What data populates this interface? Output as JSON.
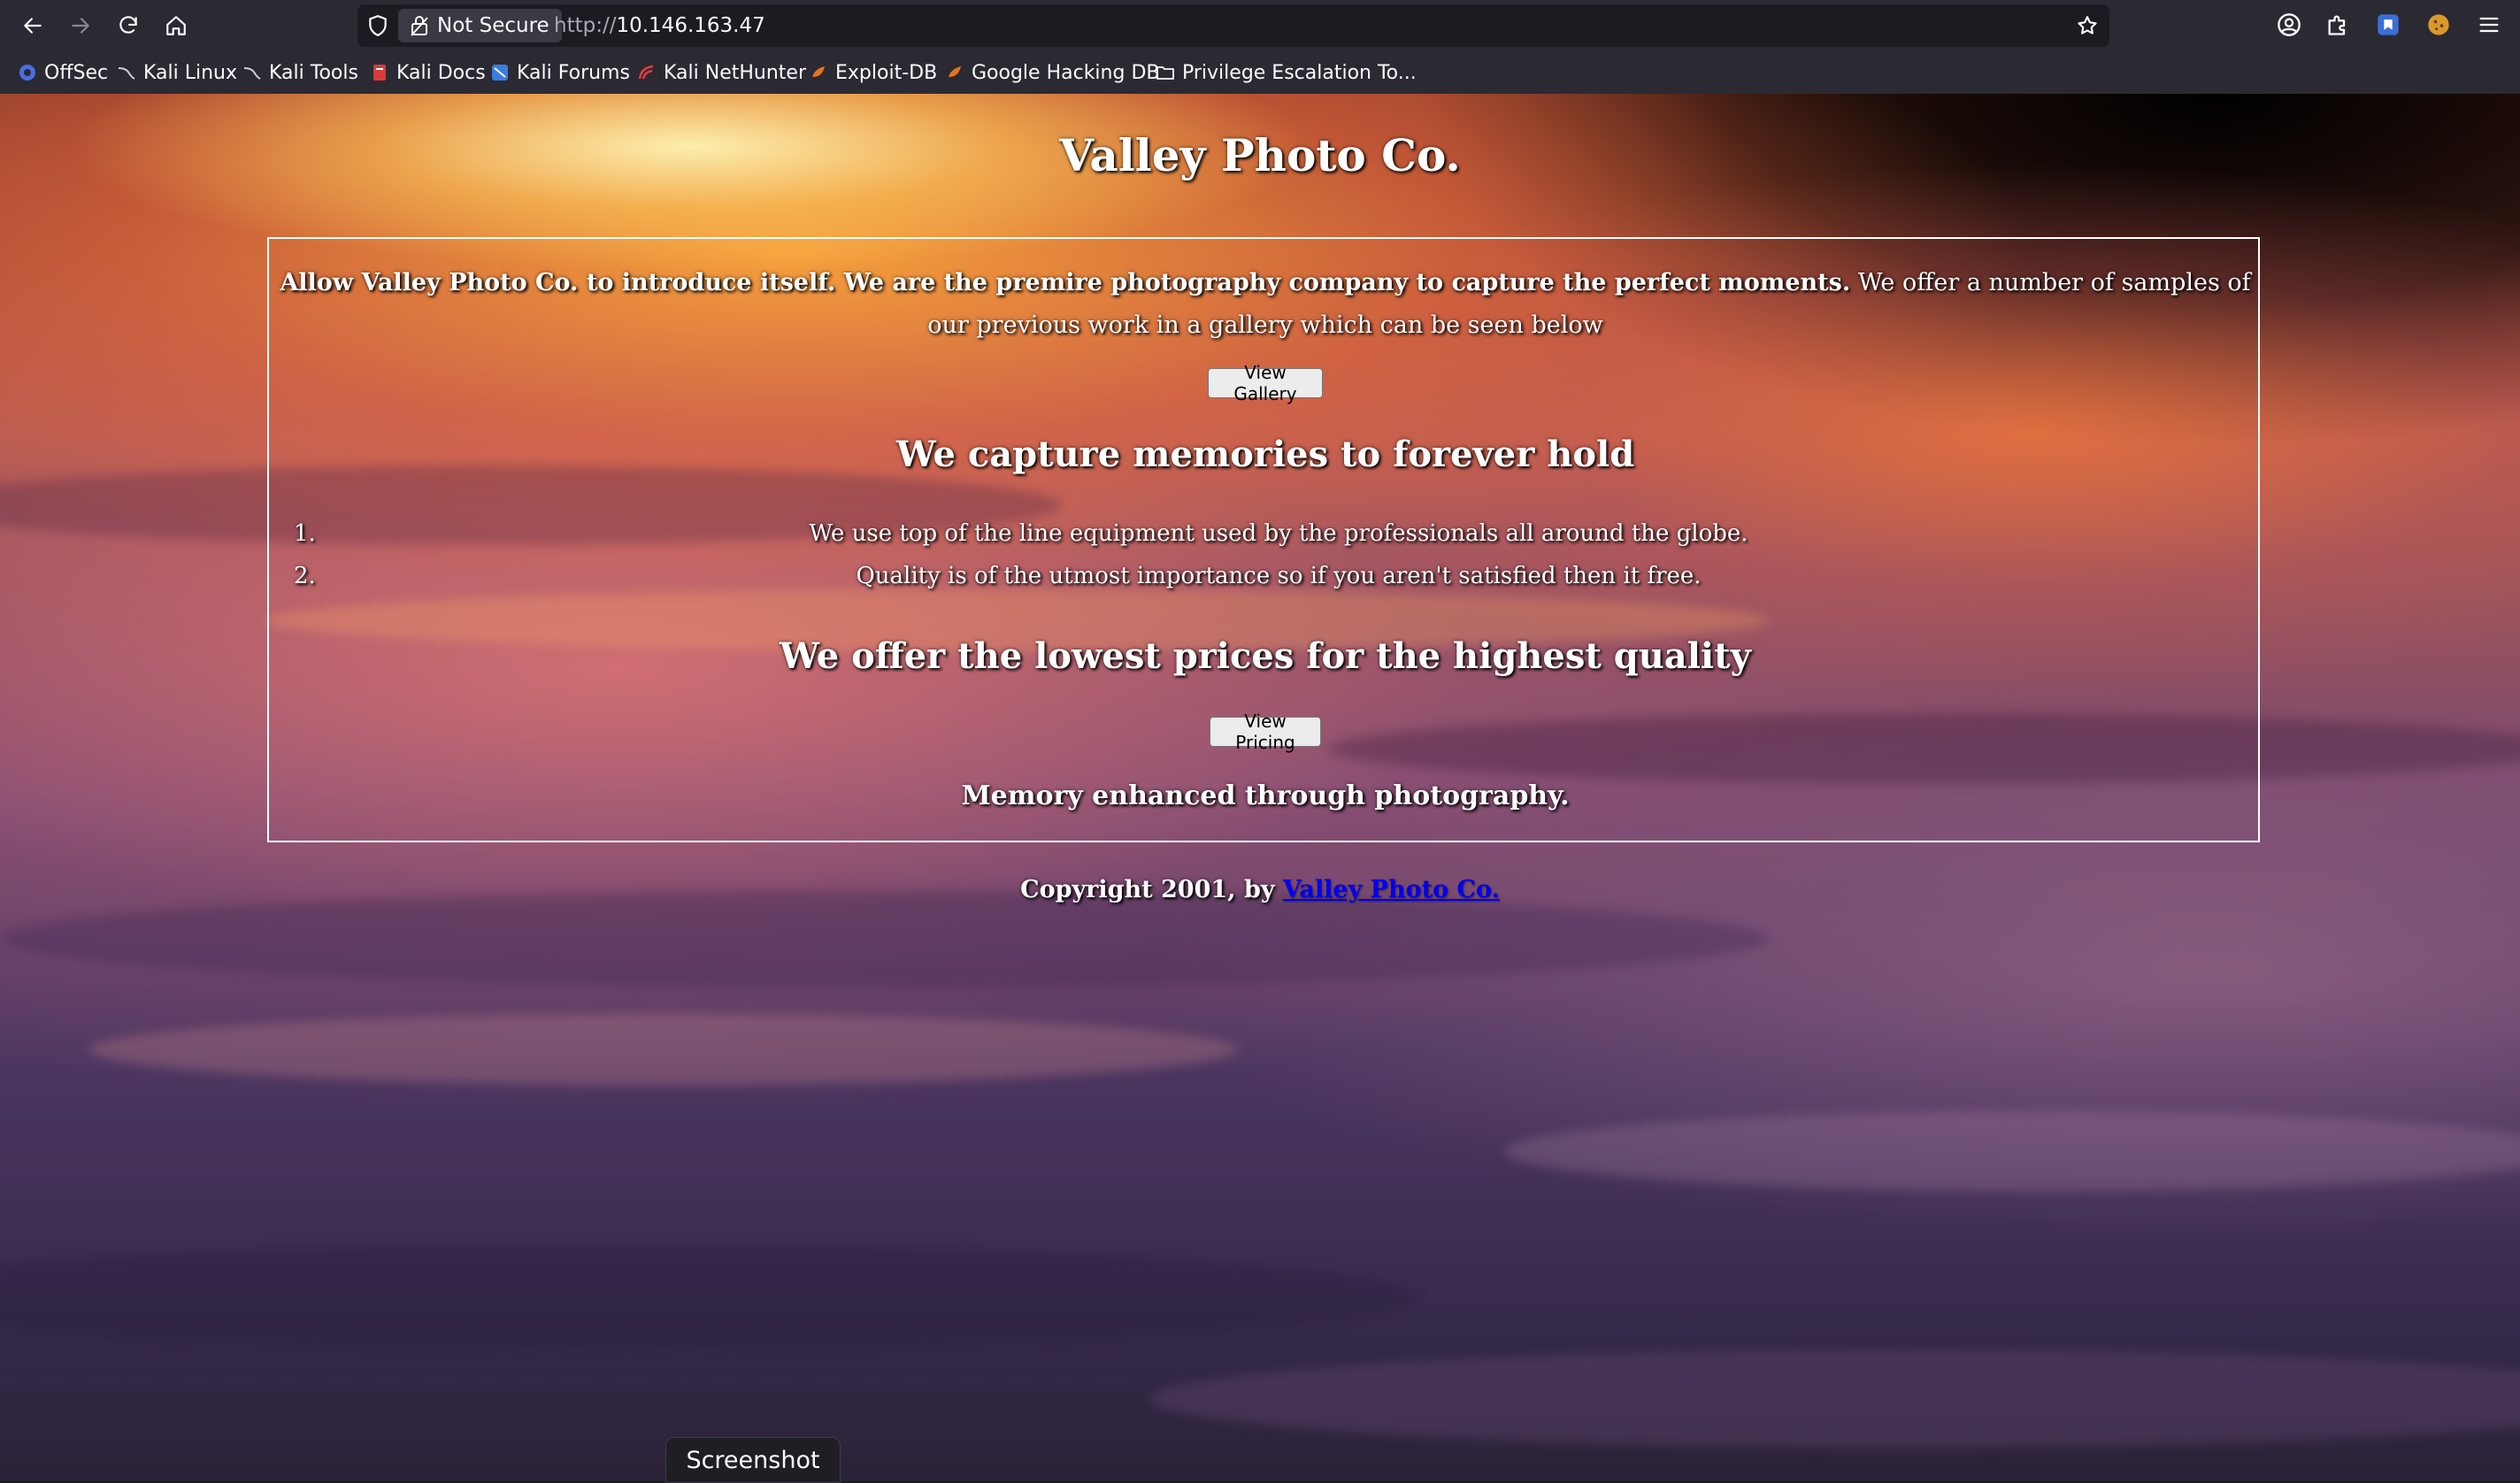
{
  "browser": {
    "security_label": "Not Secure",
    "url_protocol": "http://",
    "url_host": "10.146.163.47",
    "bookmarks": [
      {
        "label": "OffSec",
        "icon": "offsec-icon"
      },
      {
        "label": "Kali Linux",
        "icon": "kali-dragon-icon"
      },
      {
        "label": "Kali Tools",
        "icon": "kali-dragon-icon"
      },
      {
        "label": "Kali Docs",
        "icon": "kali-docs-icon"
      },
      {
        "label": "Kali Forums",
        "icon": "kali-forums-icon"
      },
      {
        "label": "Kali NetHunter",
        "icon": "nethunter-icon"
      },
      {
        "label": "Exploit-DB",
        "icon": "exploit-db-icon"
      },
      {
        "label": "Google Hacking DB",
        "icon": "ghdb-icon"
      },
      {
        "label": "Privilege Escalation To...",
        "icon": "folder-icon"
      }
    ]
  },
  "page": {
    "title": "Valley Photo Co.",
    "intro_bold": "Allow Valley Photo Co. to introduce itself. We are the premire photography company to capture the perfect moments.",
    "intro_rest": " We offer a number of samples of our previous work in a gallery which can be seen below",
    "gallery_button": "View Gallery",
    "heading_memories": "We capture memories to forever hold",
    "list": [
      {
        "num": "1.",
        "text": "We use top of the line equipment used by the professionals all around the globe."
      },
      {
        "num": "2.",
        "text": "Quality is of the utmost importance so if you aren't satisfied then it free."
      }
    ],
    "heading_prices": "We offer the lowest prices for the highest quality",
    "pricing_button": "View Pricing",
    "tagline": "Memory enhanced through photography.",
    "copyright_prefix": "Copyright 2001, by ",
    "copyright_link": "Valley Photo Co."
  },
  "overlay": {
    "screenshot_label": "Screenshot"
  },
  "colors": {
    "chrome_bg": "#2b2a33",
    "urlbar_bg": "#1c1b22",
    "link": "#0000ee"
  }
}
